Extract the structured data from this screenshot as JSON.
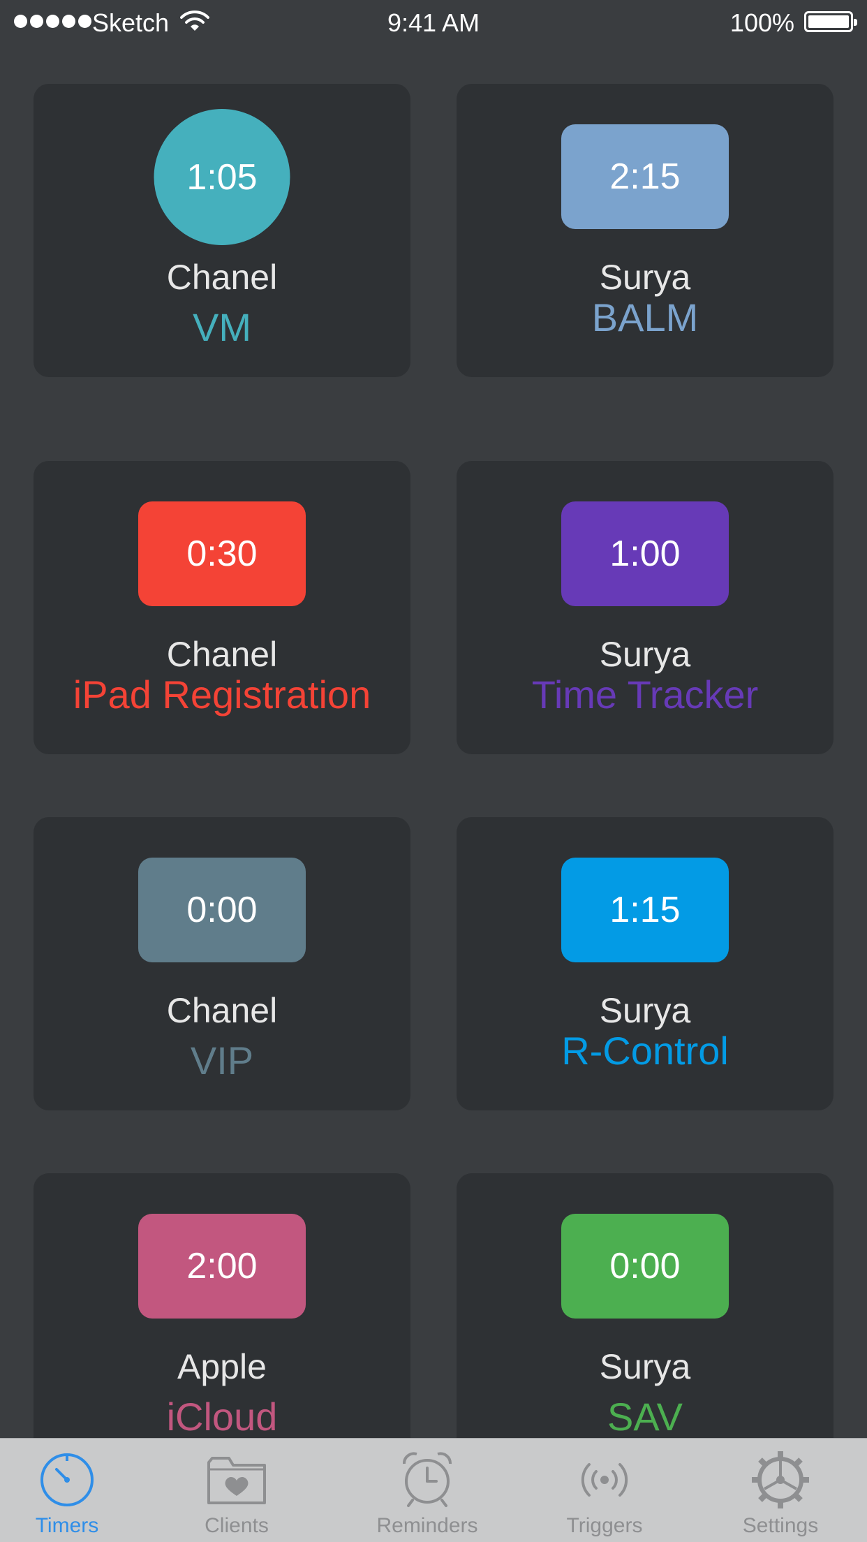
{
  "status_bar": {
    "carrier": "Sketch",
    "time": "9:41 AM",
    "battery": "100%"
  },
  "cards": [
    {
      "time": "1:05",
      "client": "Chanel",
      "project": "VM",
      "color": "#45b0bd",
      "project_color": "#45b0bd",
      "shape": "circle"
    },
    {
      "time": "2:15",
      "client": "Surya",
      "project": "BALM",
      "color": "#7ba3cd",
      "project_color": "#7ba3cd",
      "shape": "rect"
    },
    {
      "time": "0:30",
      "client": "Chanel",
      "project": "iPad Registration",
      "color": "#f44336",
      "project_color": "#f44336",
      "shape": "rect"
    },
    {
      "time": "1:00",
      "client": "Surya",
      "project": "Time Tracker",
      "color": "#673ab7",
      "project_color": "#673ab7",
      "shape": "rect"
    },
    {
      "time": "0:00",
      "client": "Chanel",
      "project": "VIP",
      "color": "#607d8b",
      "project_color": "#607d8b",
      "shape": "rect"
    },
    {
      "time": "1:15",
      "client": "Surya",
      "project": "R-Control",
      "color": "#039be5",
      "project_color": "#039be5",
      "shape": "rect"
    },
    {
      "time": "2:00",
      "client": "Apple",
      "project": "iCloud",
      "color": "#c2577f",
      "project_color": "#c2577f",
      "shape": "rect"
    },
    {
      "time": "0:00",
      "client": "Surya",
      "project": "SAV",
      "color": "#4caf50",
      "project_color": "#4caf50",
      "shape": "rect"
    }
  ],
  "tabs": [
    {
      "label": "Timers",
      "icon": "stopwatch-icon",
      "active": true
    },
    {
      "label": "Clients",
      "icon": "folder-heart-icon",
      "active": false
    },
    {
      "label": "Reminders",
      "icon": "alarm-clock-icon",
      "active": false
    },
    {
      "label": "Triggers",
      "icon": "broadcast-icon",
      "active": false
    },
    {
      "label": "Settings",
      "icon": "gear-icon",
      "active": false
    }
  ]
}
